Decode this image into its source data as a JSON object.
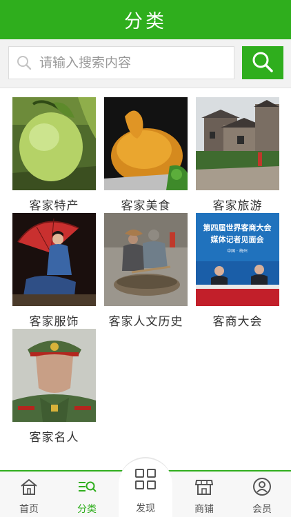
{
  "header": {
    "title": "分类"
  },
  "search": {
    "placeholder": "请输入搜索内容"
  },
  "categories": [
    {
      "label": "客家特产"
    },
    {
      "label": "客家美食"
    },
    {
      "label": "客家旅游"
    },
    {
      "label": "客家服饰"
    },
    {
      "label": "客家人文历史"
    },
    {
      "label": "客商大会"
    },
    {
      "label": "客家名人"
    }
  ],
  "banner_text": {
    "line1": "第四届世界客商大会",
    "line2": "媒体记者见面会",
    "line3": "中国 · 梅州"
  },
  "tabs": [
    {
      "label": "首页",
      "icon": "home-icon"
    },
    {
      "label": "分类",
      "icon": "category-icon",
      "active": true
    },
    {
      "label": "发现",
      "icon": "discover-grid-icon"
    },
    {
      "label": "商铺",
      "icon": "shop-icon"
    },
    {
      "label": "会员",
      "icon": "member-icon"
    }
  ],
  "colors": {
    "accent": "#2fae1d"
  }
}
